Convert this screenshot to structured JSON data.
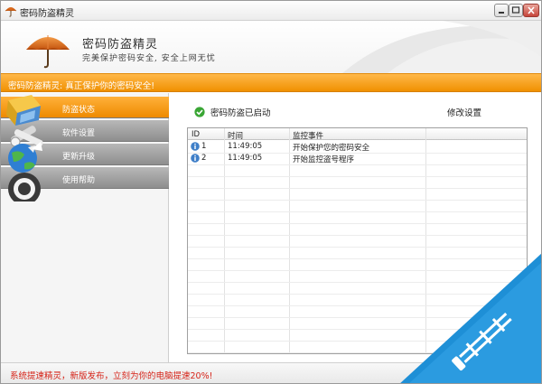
{
  "window": {
    "title": "密码防盗精灵",
    "minimize": "0",
    "maximize": "1",
    "close": "r"
  },
  "header": {
    "app_name": "密码防盗精灵",
    "tagline": "完美保护密码安全, 安全上网无忧"
  },
  "banner": {
    "text": "密码防盗精灵: 真正保护你的密码安全!"
  },
  "sidebar": {
    "items": [
      {
        "label": "防盗状态",
        "icon": "shield-icon",
        "active": true
      },
      {
        "label": "软件设置",
        "icon": "tools-icon",
        "active": false
      },
      {
        "label": "更新升级",
        "icon": "update-globe-icon",
        "active": false
      },
      {
        "label": "使用帮助",
        "icon": "help-icon",
        "active": false
      }
    ]
  },
  "main": {
    "status_text": "密码防盗已启动",
    "settings_link": "修改设置",
    "table": {
      "columns": [
        "ID",
        "时间",
        "监控事件"
      ],
      "rows": [
        {
          "id": "1",
          "time": "11:49:05",
          "event": "开始保护您的密码安全",
          "icon": "info-icon"
        },
        {
          "id": "2",
          "time": "11:49:05",
          "event": "开始监控盗号程序",
          "icon": "info-icon"
        }
      ]
    }
  },
  "footer": {
    "text": "系统提速精灵，新版发布，立刻为你的电脑提速20%!"
  },
  "watermark": {
    "text": "河东软件园",
    "color": "#1e8fd6"
  },
  "colors": {
    "accent": "#f39800",
    "nav_gray": "#9a9a9a",
    "footer_red": "#d6251a",
    "status_green": "#3aa635"
  }
}
